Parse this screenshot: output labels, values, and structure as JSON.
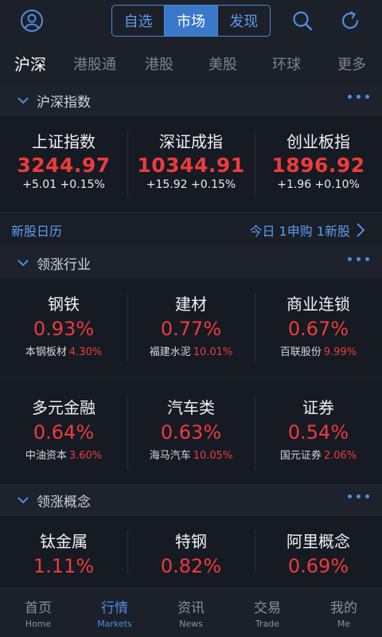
{
  "header": {
    "segments": [
      {
        "label": "自选"
      },
      {
        "label": "市场"
      },
      {
        "label": "发现"
      }
    ]
  },
  "subtabs": [
    "沪深",
    "港股通",
    "港股",
    "美股",
    "环球",
    "更多"
  ],
  "index_section": {
    "title": "沪深指数",
    "indices": [
      {
        "name": "上证指数",
        "value": "3244.97",
        "change": "+5.01  +0.15%"
      },
      {
        "name": "深证成指",
        "value": "10344.91",
        "change": "+15.92  +0.15%"
      },
      {
        "name": "创业板指",
        "value": "1896.92",
        "change": "+1.96  +0.10%"
      }
    ]
  },
  "calendar": {
    "label": "新股日历",
    "summary": "今日 1申购 1新股"
  },
  "industry_section": {
    "title": "领涨行业",
    "row1": [
      {
        "name": "钢铁",
        "pct": "0.93%",
        "leader": "本钢板材",
        "leader_pct": "4.30%"
      },
      {
        "name": "建材",
        "pct": "0.77%",
        "leader": "福建水泥",
        "leader_pct": "10.01%"
      },
      {
        "name": "商业连锁",
        "pct": "0.67%",
        "leader": "百联股份",
        "leader_pct": "9.99%"
      }
    ],
    "row2": [
      {
        "name": "多元金融",
        "pct": "0.64%",
        "leader": "中油资本",
        "leader_pct": "3.60%"
      },
      {
        "name": "汽车类",
        "pct": "0.63%",
        "leader": "海马汽车",
        "leader_pct": "10.05%"
      },
      {
        "name": "证券",
        "pct": "0.54%",
        "leader": "国元证券",
        "leader_pct": "2.06%"
      }
    ]
  },
  "concept_section": {
    "title": "领涨概念",
    "row1": [
      {
        "name": "钛金属",
        "pct": "1.11%"
      },
      {
        "name": "特钢",
        "pct": "0.82%"
      },
      {
        "name": "阿里概念",
        "pct": "0.69%"
      }
    ]
  },
  "bottom_nav": [
    {
      "zh": "首页",
      "en": "Home"
    },
    {
      "zh": "行情",
      "en": "Markets"
    },
    {
      "zh": "资讯",
      "en": "News"
    },
    {
      "zh": "交易",
      "en": "Trade"
    },
    {
      "zh": "我的",
      "en": "Me"
    }
  ],
  "colors": {
    "up": "#ee3b3b",
    "accent": "#4d8fe0",
    "background": "#161a23"
  }
}
